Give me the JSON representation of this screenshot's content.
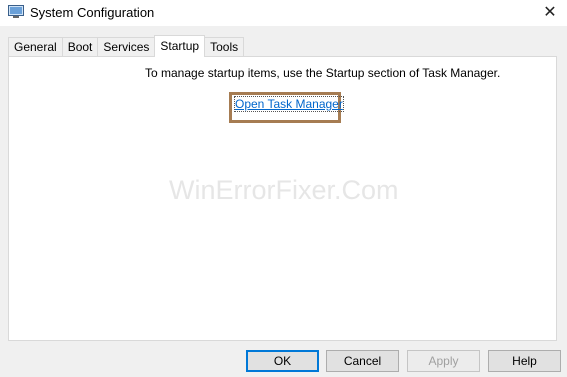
{
  "window": {
    "title": "System Configuration",
    "close_glyph": "✕"
  },
  "tabs": [
    {
      "label": "General"
    },
    {
      "label": "Boot"
    },
    {
      "label": "Services"
    },
    {
      "label": "Startup",
      "active": true
    },
    {
      "label": "Tools"
    }
  ],
  "startup": {
    "message": "To manage startup items, use the Startup section of Task Manager.",
    "link_label": "Open Task Manager"
  },
  "watermark": "WinErrorFixer.Com",
  "buttons": {
    "ok": "OK",
    "cancel": "Cancel",
    "apply": "Apply",
    "help": "Help"
  },
  "colors": {
    "highlight_border": "#a67c52",
    "link": "#0066cc",
    "default_button_border": "#0078d7"
  },
  "icons": {
    "app": "system-config-icon",
    "close": "close-icon"
  }
}
